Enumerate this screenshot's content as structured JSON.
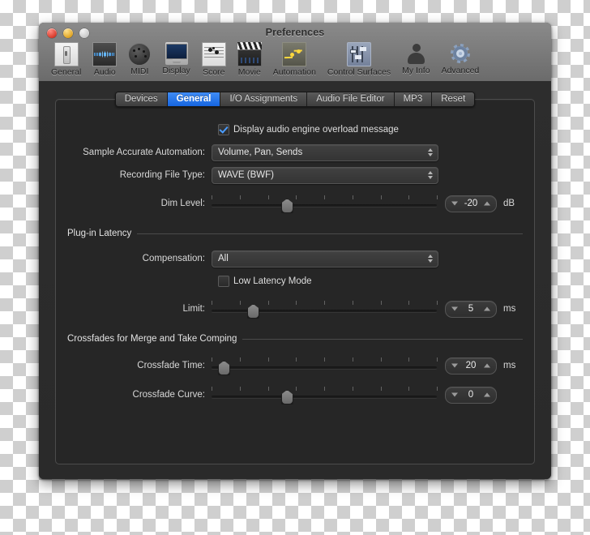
{
  "window": {
    "title": "Preferences",
    "traffic_lights": [
      "close-button",
      "minimize-button",
      "zoom-button"
    ]
  },
  "toolbar": {
    "items": [
      {
        "label": "General",
        "icon": "general-icon"
      },
      {
        "label": "Audio",
        "icon": "audio-waveform-icon"
      },
      {
        "label": "MIDI",
        "icon": "midi-port-icon"
      },
      {
        "label": "Display",
        "icon": "display-monitor-icon"
      },
      {
        "label": "Score",
        "icon": "score-notes-icon"
      },
      {
        "label": "Movie",
        "icon": "movie-clapperboard-icon"
      },
      {
        "label": "Automation",
        "icon": "automation-curve-icon"
      },
      {
        "label": "Control Surfaces",
        "icon": "control-surfaces-faders-icon"
      },
      {
        "label": "My Info",
        "icon": "my-info-person-icon"
      },
      {
        "label": "Advanced",
        "icon": "advanced-gear-icon"
      }
    ],
    "selected": "General"
  },
  "tabs": [
    {
      "label": "Devices",
      "active": false
    },
    {
      "label": "General",
      "active": true
    },
    {
      "label": "I/O Assignments",
      "active": false
    },
    {
      "label": "Audio File Editor",
      "active": false
    },
    {
      "label": "MP3",
      "active": false
    },
    {
      "label": "Reset",
      "active": false
    }
  ],
  "general": {
    "overload_checkbox": {
      "label": "Display audio engine overload message",
      "checked": true
    },
    "sample_accurate_automation": {
      "label": "Sample Accurate Automation:",
      "value": "Volume, Pan, Sends"
    },
    "recording_file_type": {
      "label": "Recording File Type:",
      "value": "WAVE (BWF)"
    },
    "dim_level": {
      "label": "Dim Level:",
      "value": "-20",
      "unit": "dB",
      "thumb_percent": 33
    }
  },
  "plugin_latency": {
    "title": "Plug-in Latency",
    "compensation": {
      "label": "Compensation:",
      "value": "All"
    },
    "low_latency_mode": {
      "label": "Low Latency Mode",
      "checked": false
    },
    "limit": {
      "label": "Limit:",
      "value": "5",
      "unit": "ms",
      "thumb_percent": 18
    }
  },
  "crossfades": {
    "title": "Crossfades for Merge and Take Comping",
    "crossfade_time": {
      "label": "Crossfade Time:",
      "value": "20",
      "unit": "ms",
      "thumb_percent": 5
    },
    "crossfade_curve": {
      "label": "Crossfade Curve:",
      "value": "0",
      "unit": "",
      "thumb_percent": 33
    }
  },
  "colors": {
    "accent_blue": "#1665e0",
    "window_chrome": "#7e7e7e",
    "panel_background": "#262626",
    "text_primary": "#d8d8d8"
  }
}
